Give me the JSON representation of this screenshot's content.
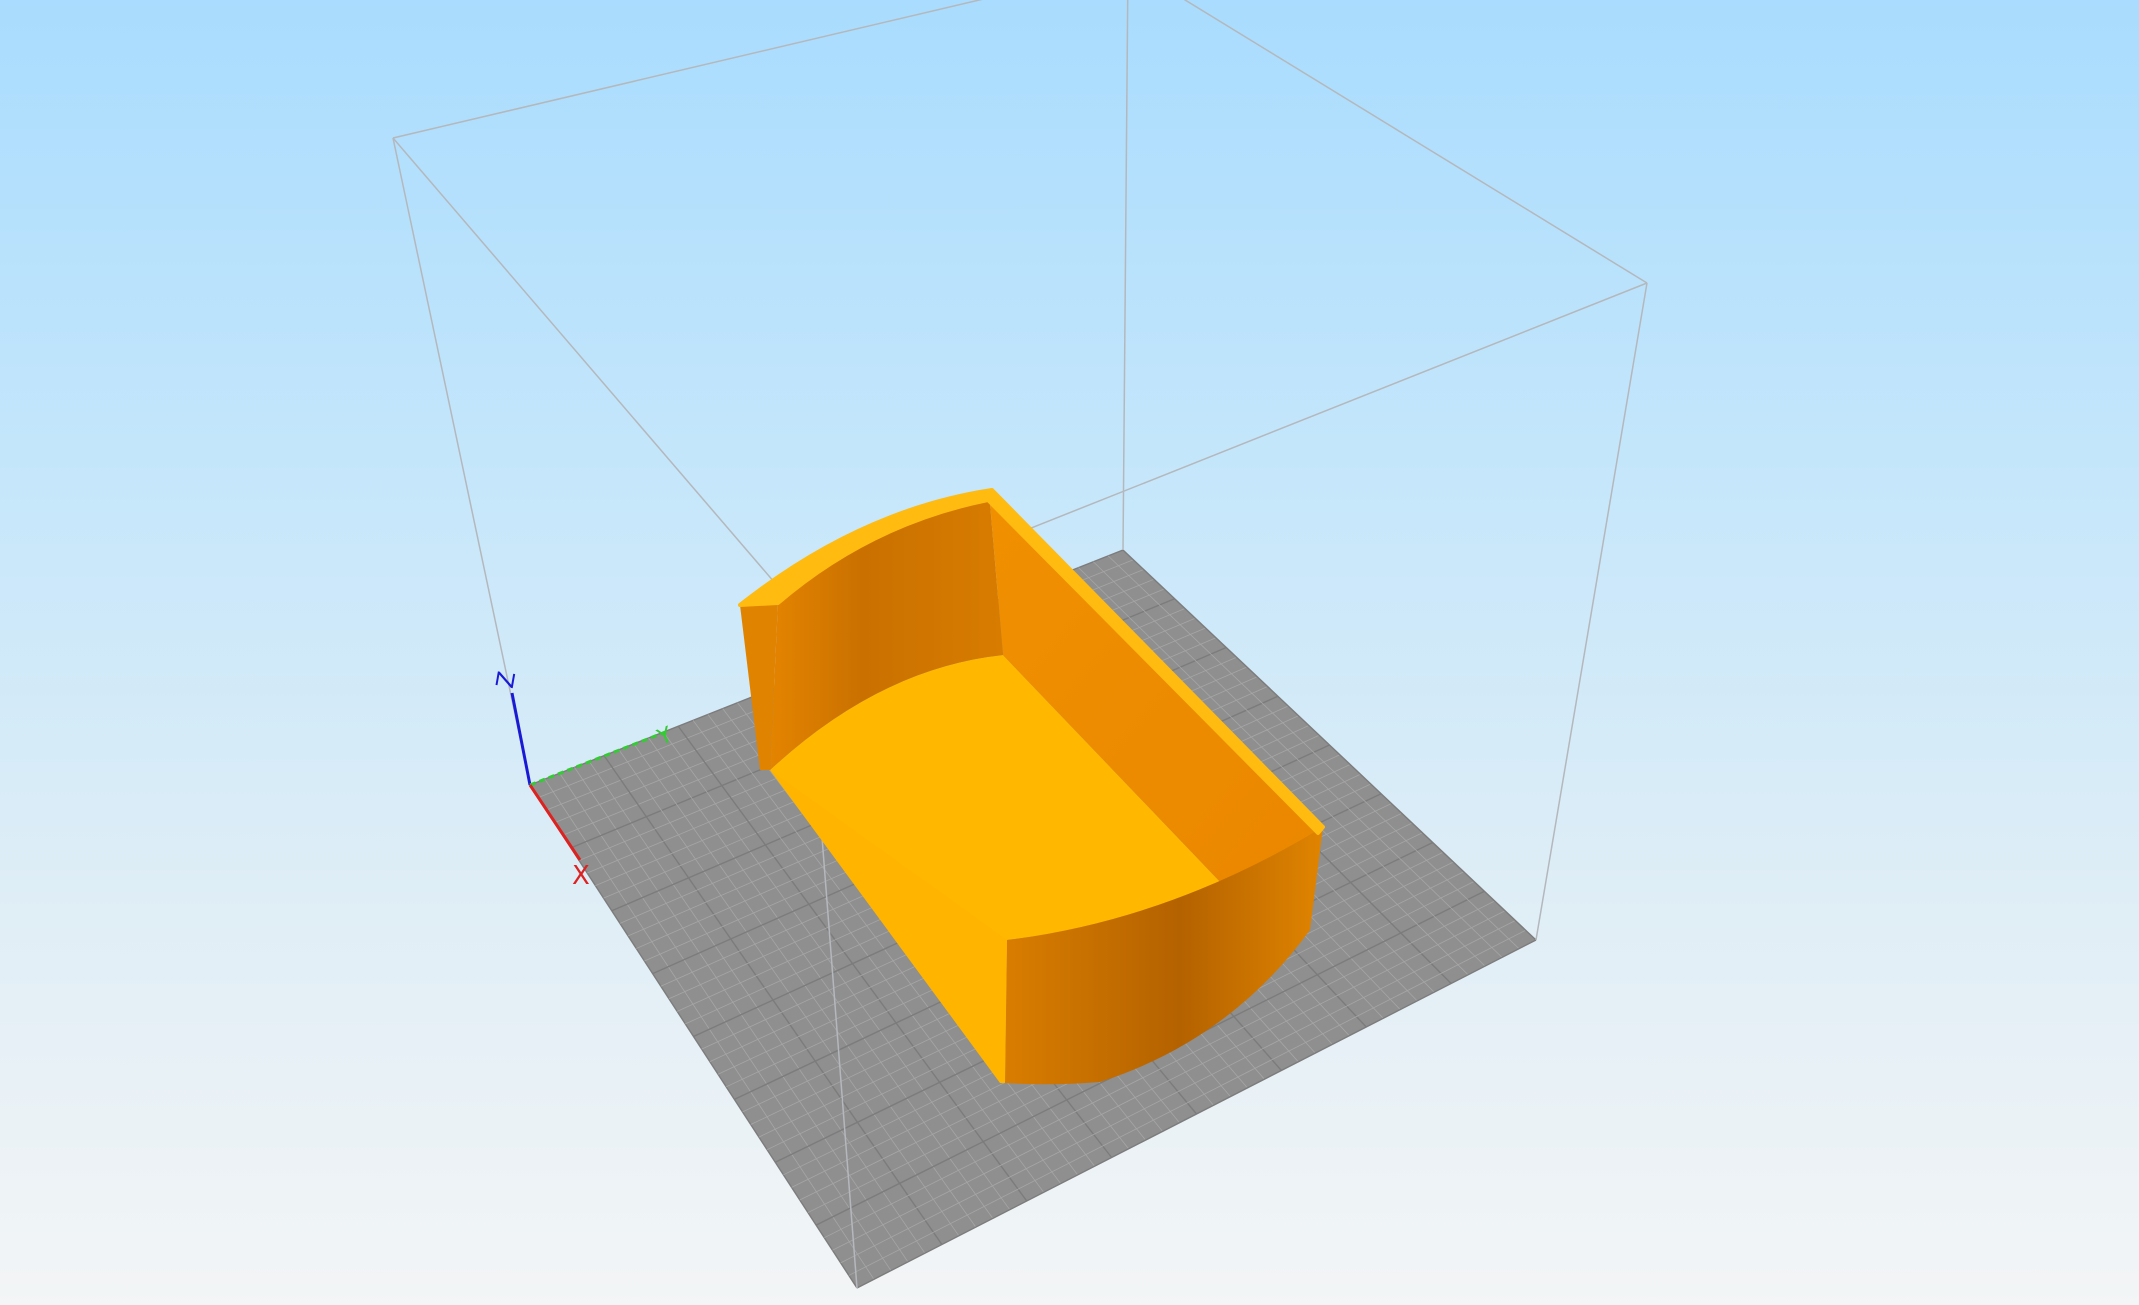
{
  "viewport": {
    "background_top": "#a9dcfe",
    "background_bottom": "#f3f5f6"
  },
  "build_plate": {
    "color": "#8f8f8f",
    "grid_color": "#a6a6a6"
  },
  "bounding_box": {
    "line_color": "#b4b8bc"
  },
  "axes": {
    "x": {
      "label": "X",
      "color": "#dd2222"
    },
    "y": {
      "label": "Y",
      "color": "#33cc33"
    },
    "z": {
      "label": "Z",
      "color": "#1a1ad6"
    }
  },
  "model": {
    "color": "#ffb700",
    "wall_color_light": "#ee8a00",
    "wall_color_dark": "#c26a00",
    "rim_color": "#ffbb10"
  }
}
